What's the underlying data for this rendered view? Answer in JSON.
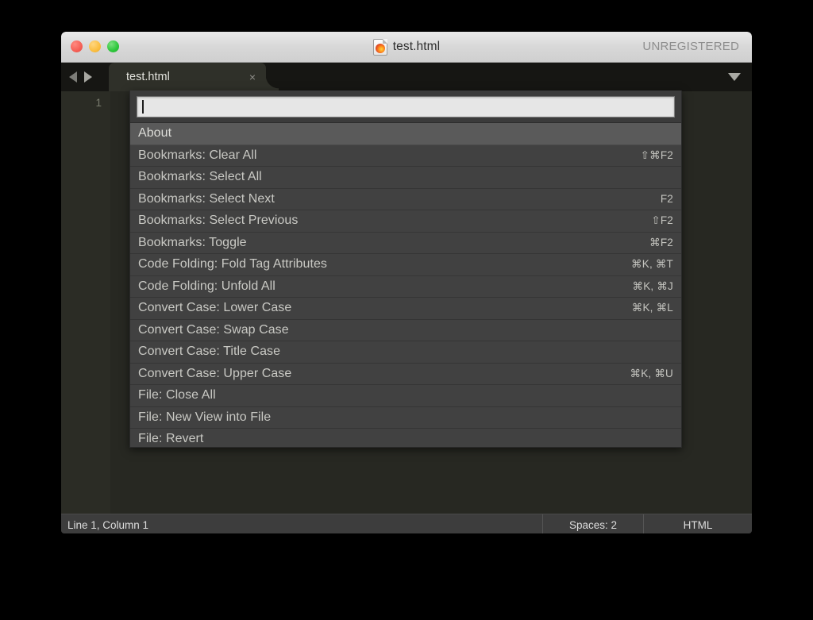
{
  "window": {
    "title": "test.html",
    "title_icon": "firefox-document-icon",
    "registration_status": "UNREGISTERED",
    "traffic_lights": [
      {
        "name": "close",
        "color": "#f55f55"
      },
      {
        "name": "minimize",
        "color": "#fbbe40"
      },
      {
        "name": "maximize",
        "color": "#2cc63a"
      }
    ]
  },
  "tabbar": {
    "nav_prev_icon": "triangle-left-icon",
    "nav_next_icon": "triangle-right-icon",
    "menu_icon": "chevron-down-icon",
    "tabs": [
      {
        "label": "test.html",
        "close_icon": "×",
        "active": true
      }
    ]
  },
  "gutter": {
    "line_numbers": [
      "1"
    ]
  },
  "palette": {
    "input_value": "",
    "input_placeholder": "",
    "items": [
      {
        "label": "About",
        "shortcut": "",
        "selected": true
      },
      {
        "label": "Bookmarks: Clear All",
        "shortcut": "⇧⌘F2",
        "selected": false
      },
      {
        "label": "Bookmarks: Select All",
        "shortcut": "",
        "selected": false
      },
      {
        "label": "Bookmarks: Select Next",
        "shortcut": "F2",
        "selected": false
      },
      {
        "label": "Bookmarks: Select Previous",
        "shortcut": "⇧F2",
        "selected": false
      },
      {
        "label": "Bookmarks: Toggle",
        "shortcut": "⌘F2",
        "selected": false
      },
      {
        "label": "Code Folding: Fold Tag Attributes",
        "shortcut": "⌘K, ⌘T",
        "selected": false
      },
      {
        "label": "Code Folding: Unfold All",
        "shortcut": "⌘K, ⌘J",
        "selected": false
      },
      {
        "label": "Convert Case: Lower Case",
        "shortcut": "⌘K, ⌘L",
        "selected": false
      },
      {
        "label": "Convert Case: Swap Case",
        "shortcut": "",
        "selected": false
      },
      {
        "label": "Convert Case: Title Case",
        "shortcut": "",
        "selected": false
      },
      {
        "label": "Convert Case: Upper Case",
        "shortcut": "⌘K, ⌘U",
        "selected": false
      },
      {
        "label": "File: Close All",
        "shortcut": "",
        "selected": false
      },
      {
        "label": "File: New View into File",
        "shortcut": "",
        "selected": false
      },
      {
        "label": "File: Revert",
        "shortcut": "",
        "selected": false
      }
    ]
  },
  "statusbar": {
    "position": "Line 1, Column 1",
    "indentation": "Spaces: 2",
    "syntax": "HTML"
  },
  "colors": {
    "editor_background": "#272822",
    "palette_background": "#414141",
    "palette_selected": "#5a5a5a",
    "tabbar_background": "#161613",
    "active_tab": "#2f3029",
    "statusbar_background": "#3d3d3d"
  }
}
